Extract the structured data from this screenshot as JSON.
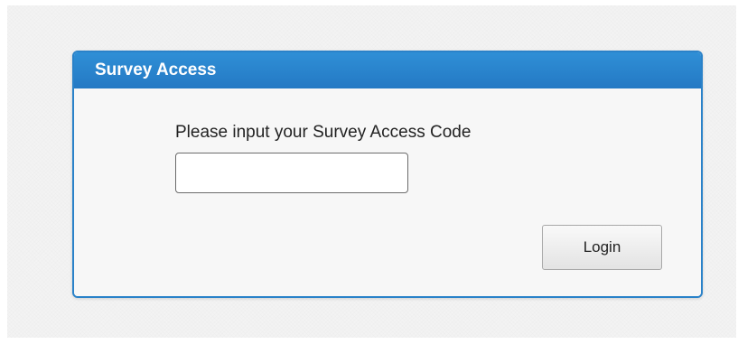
{
  "panel": {
    "title": "Survey Access"
  },
  "form": {
    "prompt": "Please input your Survey Access Code",
    "code_value": "",
    "code_placeholder": "",
    "login_label": "Login"
  },
  "colors": {
    "header_blue": "#2479c4",
    "panel_border": "#2a82c9",
    "panel_bg": "#f7f7f7"
  }
}
